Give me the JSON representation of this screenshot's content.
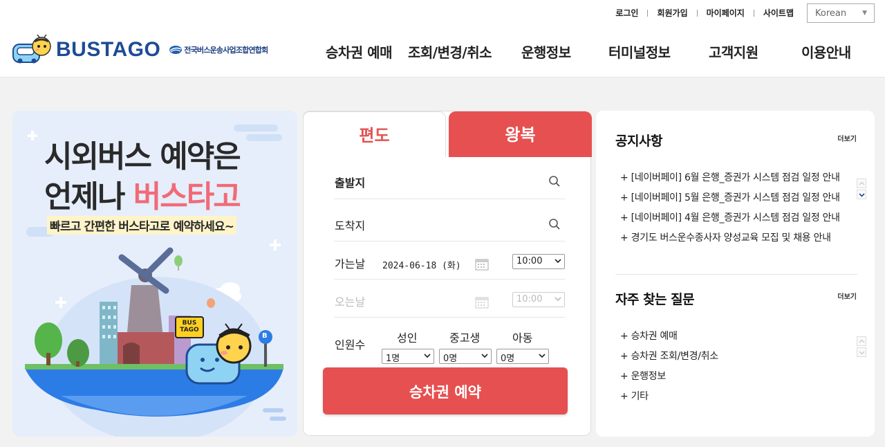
{
  "header": {
    "util_links": [
      "로그인",
      "회원가입",
      "마이페이지",
      "사이트맵"
    ],
    "language": "Korean",
    "logo_text": "BUSTAGO",
    "association": "전국버스운송사업조합연합회",
    "nav": [
      "승차권 예매",
      "조회/변경/취소",
      "운행정보",
      "터미널정보",
      "고객지원",
      "이용안내"
    ]
  },
  "banner": {
    "line1": "시외버스 예약은",
    "line2_prefix": "언제나 ",
    "line2_highlight": "버스타고",
    "subtitle": "빠르고 간편한 버스타고로 예약하세요~",
    "sign_text": "BUS TAGO",
    "stop_sign": "B"
  },
  "booking": {
    "tab_one_way": "편도",
    "tab_round_trip": "왕복",
    "departure_label": "출발지",
    "arrival_label": "도착지",
    "depart_date_label": "가는날",
    "depart_date_value": "2024-06-18 (화)",
    "depart_time": "10:00",
    "return_date_label": "오는날",
    "return_time": "10:00",
    "passengers_label": "인원수",
    "adult_label": "성인",
    "youth_label": "중고생",
    "child_label": "아동",
    "adult_count": "1명",
    "youth_count": "0명",
    "child_count": "0명",
    "submit": "승차권 예약"
  },
  "notices": {
    "title": "공지사항",
    "more": "더보기",
    "items": [
      "+ [네이버페이] 6월 은행_증권가 시스템 점검 일정 안내",
      "+ [네이버페이] 5월 은행_증권가 시스템 점검 일정 안내",
      "+ [네이버페이] 4월 은행_증권가 시스템 점검 일정 안내",
      "+ 경기도 버스운수종사자 양성교육 모집 및 채용 안내"
    ]
  },
  "faq": {
    "title": "자주 찾는 질문",
    "more": "더보기",
    "items": [
      "+ 승차권 예매",
      "+ 승차권 조회/변경/취소",
      "+ 운행정보",
      "+ 기타"
    ]
  },
  "colors": {
    "brand_red": "#e65050",
    "brand_blue": "#1e4b94",
    "banner_pink": "#f06b77",
    "background": "#f2f2f2"
  }
}
